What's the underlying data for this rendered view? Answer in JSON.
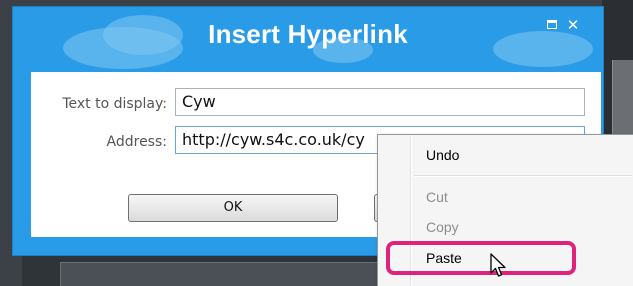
{
  "dialog": {
    "title": "Insert Hyperlink",
    "maximize_icon": "maximize-icon",
    "close_icon": "close-icon",
    "text_to_display_label": "Text to display:",
    "text_to_display_value": "Cyw",
    "address_label": "Address:",
    "address_value": "http://cyw.s4c.co.uk/cy",
    "ok_label": "OK",
    "colors": {
      "title_bar": "#2a9be6",
      "body": "#ffffff"
    }
  },
  "context_menu": {
    "items": [
      {
        "label": "Undo",
        "enabled": true
      },
      {
        "label": "Cut",
        "enabled": false
      },
      {
        "label": "Copy",
        "enabled": false
      },
      {
        "label": "Paste",
        "enabled": true,
        "highlighted": true
      }
    ],
    "highlight_color": "#e0237a"
  },
  "cursor_icon": "arrow-cursor-icon"
}
